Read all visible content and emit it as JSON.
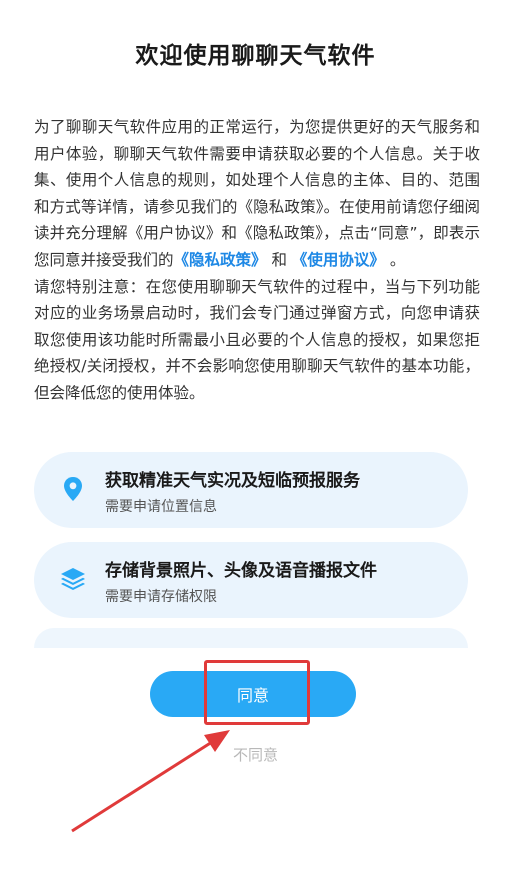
{
  "dialog": {
    "title": "欢迎使用聊聊天气软件",
    "para1_a": "为了聊聊天气软件应用的正常运行，为您提供更好的天气服务和用户体验，聊聊天气软件需要申请获取必要的个人信息。关于收集、使用个人信息的规则，如处理个人信息的主体、目的、范围和方式等详情，请参见我们的《隐私政策》。在使用前请您仔细阅读并充分理解《用户协议》和《隐私政策》，点击“同意”，即表示您同意并接受我们的",
    "privacy_link": "《隐私政策》",
    "and_text": " 和 ",
    "terms_link": "《使用协议》",
    "para1_end": " 。",
    "para2": "请您特别注意：在您使用聊聊天气软件的过程中，当与下列功能对应的业务场景启动时，我们会专门通过弹窗方式，向您申请获取您使用该功能时所需最小且必要的个人信息的授权，如果您拒绝授权/关闭授权，并不会影响您使用聊聊天气软件的基本功能，但会降低您的使用体验。"
  },
  "permissions": [
    {
      "title": "获取精准天气实况及短临预报服务",
      "subtitle": "需要申请位置信息",
      "icon": "location-pin-icon"
    },
    {
      "title": "存储背景照片、头像及语音播报文件",
      "subtitle": "需要申请存储权限",
      "icon": "layers-icon"
    }
  ],
  "buttons": {
    "agree_label": "同意",
    "disagree_label": "不同意"
  },
  "colors": {
    "accent": "#29a9f5",
    "link": "#1e88e5",
    "card_bg": "#eaf4fd",
    "annotation": "#e03a3a"
  }
}
